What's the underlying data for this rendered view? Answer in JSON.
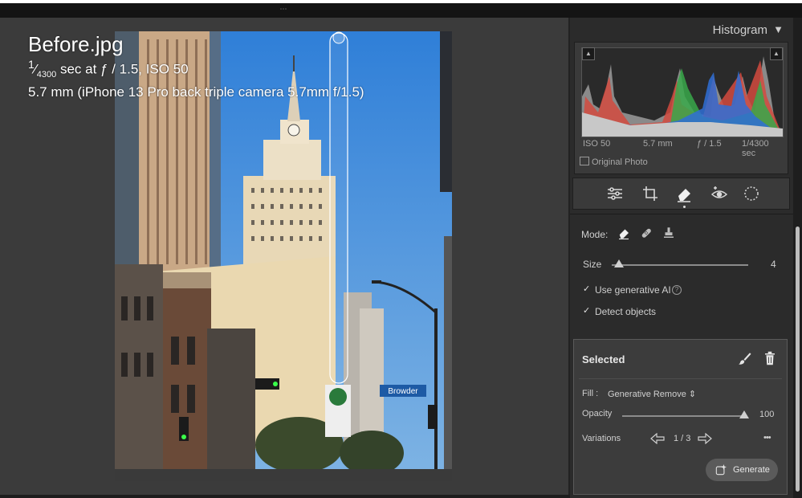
{
  "overlay": {
    "filename": "Before.jpg",
    "exposure_numerator": "1",
    "exposure_denominator": "4300",
    "exposure_rest": "sec at ƒ / 1.5, ISO 50",
    "lens": "5.7 mm (iPhone 13 Pro back triple camera 5.7mm f/1.5)"
  },
  "histogram": {
    "title": "Histogram",
    "iso": "ISO 50",
    "focal": "5.7 mm",
    "aperture": "ƒ / 1.5",
    "shutter": "1/4300 sec",
    "original_photo": "Original Photo"
  },
  "photo": {
    "sign_text": "Browder"
  },
  "tools": {
    "mode_label": "Mode:",
    "size_label": "Size",
    "size_value": "4",
    "size_fraction": 0.05,
    "use_generative_ai": "Use generative AI",
    "detect_objects": "Detect objects"
  },
  "selected": {
    "title": "Selected",
    "fill_label": "Fill :",
    "fill_value": "Generative Remove",
    "opacity_label": "Opacity",
    "opacity_value": "100",
    "opacity_fraction": 1.0,
    "variations_label": "Variations",
    "variations_value": "1 / 3",
    "more": "•••",
    "generate_label": "Generate"
  },
  "colors": {
    "accent": "#cfcfcf",
    "sky": "#3f8bd6",
    "panel": "#3c3c3c"
  }
}
